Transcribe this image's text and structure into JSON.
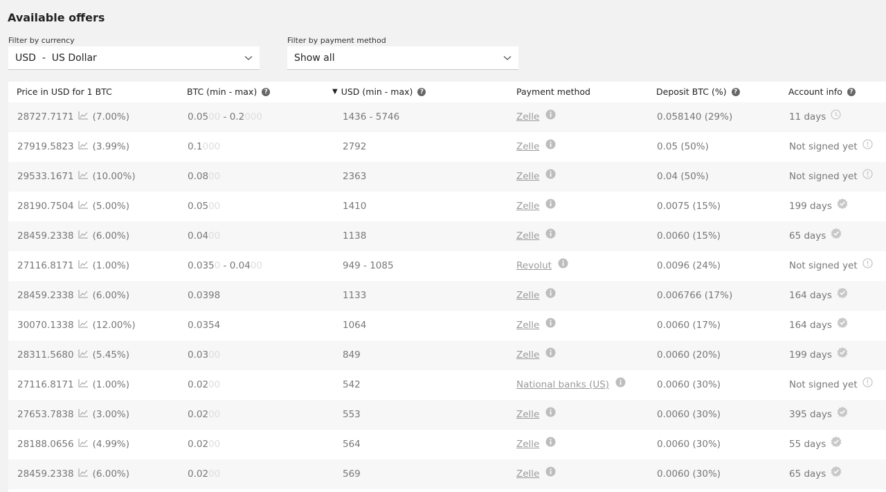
{
  "page": {
    "title": "Available offers"
  },
  "filters": {
    "currency": {
      "label": "Filter by currency",
      "value": "USD  -  US Dollar"
    },
    "payment": {
      "label": "Filter by payment method",
      "value": "Show all"
    }
  },
  "table": {
    "headers": {
      "price": "Price in USD for 1 BTC",
      "btc": "BTC (min - max)",
      "usd_sort": "▼",
      "usd": "USD (min - max)",
      "payment": "Payment method",
      "deposit": "Deposit BTC (%)",
      "account": "Account info"
    },
    "rows": [
      {
        "price": "28727.7171",
        "pct": "(7.00%)",
        "btc_min": "0.05",
        "btc_min_pad": "00",
        "btc_sep": " - ",
        "btc_max": "0.2",
        "btc_max_pad": "000",
        "usd": "1436 - 5746",
        "payment": "Zelle",
        "deposit": "0.058140 (29%)",
        "account": "11 days",
        "acc_icon": "clock-icon"
      },
      {
        "price": "27919.5823",
        "pct": "(3.99%)",
        "btc_min": "0.1",
        "btc_min_pad": "000",
        "btc_sep": "",
        "btc_max": "",
        "btc_max_pad": "",
        "usd": "2792",
        "payment": "Zelle",
        "deposit": "0.05 (50%)",
        "account": "Not signed yet",
        "acc_icon": "alert-circle-icon"
      },
      {
        "price": "29533.1671",
        "pct": "(10.00%)",
        "btc_min": "0.08",
        "btc_min_pad": "00",
        "btc_sep": "",
        "btc_max": "",
        "btc_max_pad": "",
        "usd": "2363",
        "payment": "Zelle",
        "deposit": "0.04 (50%)",
        "account": "Not signed yet",
        "acc_icon": "alert-circle-icon"
      },
      {
        "price": "28190.7504",
        "pct": "(5.00%)",
        "btc_min": "0.05",
        "btc_min_pad": "00",
        "btc_sep": "",
        "btc_max": "",
        "btc_max_pad": "",
        "usd": "1410",
        "payment": "Zelle",
        "deposit": "0.0075 (15%)",
        "account": "199 days",
        "acc_icon": "verified-badge-icon"
      },
      {
        "price": "28459.2338",
        "pct": "(6.00%)",
        "btc_min": "0.04",
        "btc_min_pad": "00",
        "btc_sep": "",
        "btc_max": "",
        "btc_max_pad": "",
        "usd": "1138",
        "payment": "Zelle",
        "deposit": "0.0060 (15%)",
        "account": "65 days",
        "acc_icon": "verified-badge-icon"
      },
      {
        "price": "27116.8171",
        "pct": "(1.00%)",
        "btc_min": "0.035",
        "btc_min_pad": "0",
        "btc_sep": " - ",
        "btc_max": "0.04",
        "btc_max_pad": "00",
        "usd": "949 - 1085",
        "payment": "Revolut",
        "deposit": "0.0096 (24%)",
        "account": "Not signed yet",
        "acc_icon": "alert-circle-icon"
      },
      {
        "price": "28459.2338",
        "pct": "(6.00%)",
        "btc_min": "0.0398",
        "btc_min_pad": "",
        "btc_sep": "",
        "btc_max": "",
        "btc_max_pad": "",
        "usd": "1133",
        "payment": "Zelle",
        "deposit": "0.006766 (17%)",
        "account": "164 days",
        "acc_icon": "verified-badge-icon"
      },
      {
        "price": "30070.1338",
        "pct": "(12.00%)",
        "btc_min": "0.0354",
        "btc_min_pad": "",
        "btc_sep": "",
        "btc_max": "",
        "btc_max_pad": "",
        "usd": "1064",
        "payment": "Zelle",
        "deposit": "0.0060 (17%)",
        "account": "164 days",
        "acc_icon": "verified-badge-icon"
      },
      {
        "price": "28311.5680",
        "pct": "(5.45%)",
        "btc_min": "0.03",
        "btc_min_pad": "00",
        "btc_sep": "",
        "btc_max": "",
        "btc_max_pad": "",
        "usd": "849",
        "payment": "Zelle",
        "deposit": "0.0060 (20%)",
        "account": "199 days",
        "acc_icon": "verified-badge-icon"
      },
      {
        "price": "27116.8171",
        "pct": "(1.00%)",
        "btc_min": "0.02",
        "btc_min_pad": "00",
        "btc_sep": "",
        "btc_max": "",
        "btc_max_pad": "",
        "usd": "542",
        "payment": "National banks (US)",
        "deposit": "0.0060 (30%)",
        "account": "Not signed yet",
        "acc_icon": "alert-circle-icon"
      },
      {
        "price": "27653.7838",
        "pct": "(3.00%)",
        "btc_min": "0.02",
        "btc_min_pad": "00",
        "btc_sep": "",
        "btc_max": "",
        "btc_max_pad": "",
        "usd": "553",
        "payment": "Zelle",
        "deposit": "0.0060 (30%)",
        "account": "395 days",
        "acc_icon": "verified-badge-icon"
      },
      {
        "price": "28188.0656",
        "pct": "(4.99%)",
        "btc_min": "0.02",
        "btc_min_pad": "00",
        "btc_sep": "",
        "btc_max": "",
        "btc_max_pad": "",
        "usd": "564",
        "payment": "Zelle",
        "deposit": "0.0060 (30%)",
        "account": "55 days",
        "acc_icon": "verified-badge-icon"
      },
      {
        "price": "28459.2338",
        "pct": "(6.00%)",
        "btc_min": "0.02",
        "btc_min_pad": "00",
        "btc_sep": "",
        "btc_max": "",
        "btc_max_pad": "",
        "usd": "569",
        "payment": "Zelle",
        "deposit": "0.0060 (30%)",
        "account": "65 days",
        "acc_icon": "verified-badge-icon"
      }
    ]
  },
  "icons": {
    "trend": "trend-chart-icon",
    "info": "info-circle-icon",
    "help": "help-circle-icon",
    "chevron": "chevron-down-icon"
  },
  "colors": {
    "background": "#f2f2f2",
    "text": "#777777",
    "link": "#9a9a9a",
    "icon": "#bfbfbf"
  }
}
